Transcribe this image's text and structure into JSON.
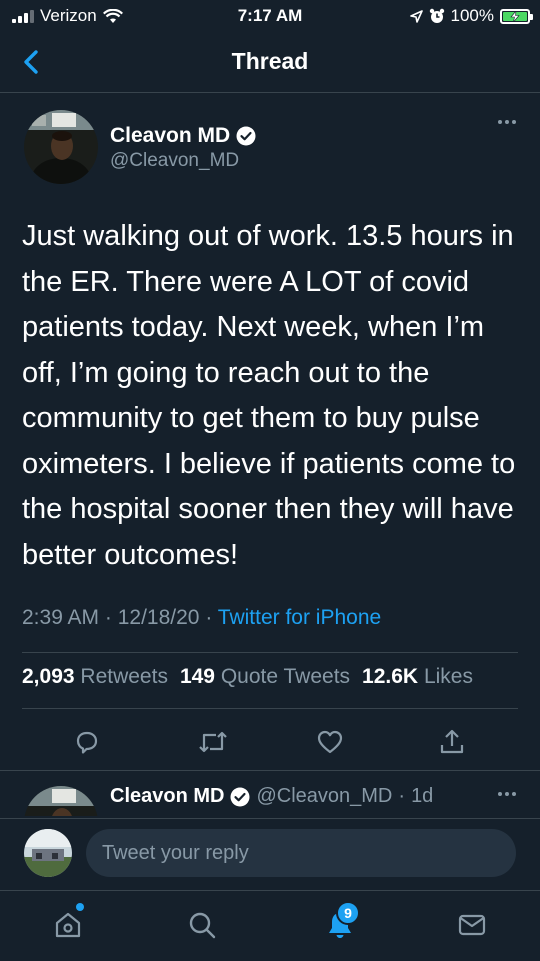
{
  "status_bar": {
    "carrier": "Verizon",
    "time": "7:17 AM",
    "battery": "100%",
    "battery_level": 1.0
  },
  "header": {
    "title": "Thread"
  },
  "tweet": {
    "display_name": "Cleavon MD",
    "handle": "@Cleavon_MD",
    "text": "Just walking out of work. 13.5 hours in the ER. There were A LOT of covid patients today. Next week, when I’m off, I’m going to reach out to the community to get them to buy pulse oximeters. I believe if patients come to the hospital sooner then they will have better outcomes!",
    "time": "2:39 AM",
    "date": "12/18/20",
    "source": "Twitter for iPhone",
    "retweets_count": "2,093",
    "retweets_label": "Retweets",
    "quotes_count": "149",
    "quotes_label": "Quote Tweets",
    "likes_count": "12.6K",
    "likes_label": "Likes"
  },
  "reply_tweet": {
    "display_name": "Cleavon MD",
    "handle": "@Cleavon_MD",
    "age": "1d"
  },
  "compose": {
    "placeholder": "Tweet your reply"
  },
  "tabbar": {
    "notifications_badge": "9"
  },
  "colors": {
    "background": "#15202b",
    "accent": "#1da1f2",
    "secondary_text": "#8899a6",
    "divider": "#38444d"
  },
  "icons": {
    "back": "chevron-left-icon",
    "verified": "verified-badge-icon",
    "more": "more-horizontal-icon",
    "reply": "reply-icon",
    "retweet": "retweet-icon",
    "like": "heart-icon",
    "share": "share-icon",
    "home": "home-icon",
    "search": "search-icon",
    "notifications": "bell-icon",
    "messages": "mail-icon"
  }
}
